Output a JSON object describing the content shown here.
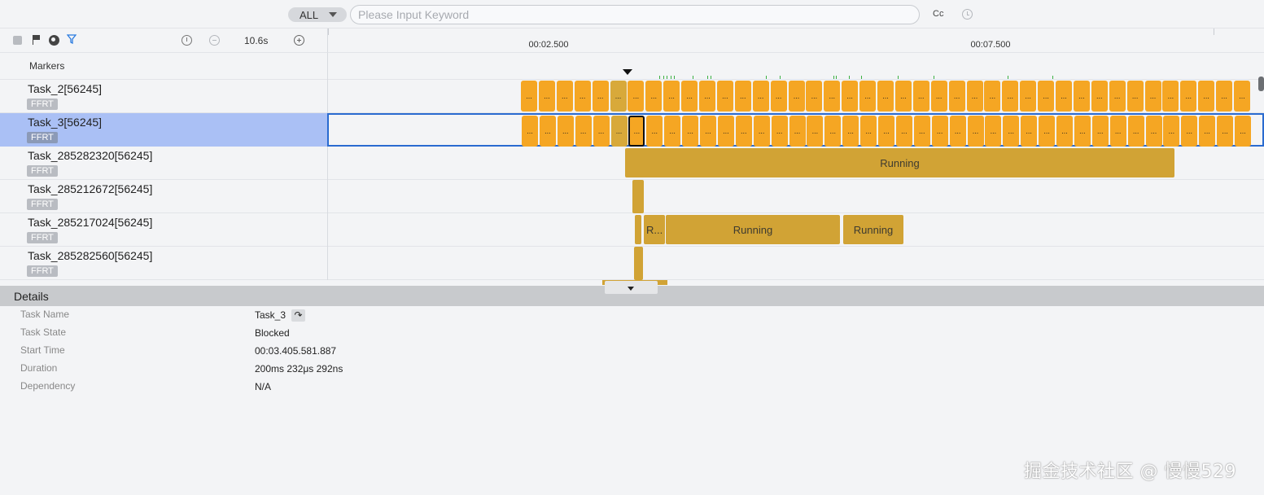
{
  "search": {
    "scope": "ALL",
    "placeholder": "Please Input Keyword",
    "value": "",
    "case_toggle": "Cc"
  },
  "toolbar": {
    "zoom_level": "10.6s",
    "icons": [
      "stop-icon",
      "flag-icon",
      "globe-icon",
      "filter-icon",
      "timer-icon",
      "zoom-out-icon",
      "zoom-in-icon"
    ]
  },
  "ruler": {
    "labels": [
      "00:02.500",
      "00:07.500"
    ]
  },
  "markers": {
    "label": "Markers"
  },
  "tracks": [
    {
      "name": "Task_2[56245]",
      "tag": "FFRT"
    },
    {
      "name": "Task_3[56245]",
      "tag": "FFRT",
      "selected": true
    },
    {
      "name": "Task_285282320[56245]",
      "tag": "FFRT",
      "slices": [
        {
          "label": "Running"
        }
      ]
    },
    {
      "name": "Task_285212672[56245]",
      "tag": "FFRT"
    },
    {
      "name": "Task_285217024[56245]",
      "tag": "FFRT",
      "slices": [
        {
          "label": "R..."
        },
        {
          "label": "Running"
        },
        {
          "label": "Running"
        }
      ]
    },
    {
      "name": "Task_285282560[56245]",
      "tag": "FFRT"
    }
  ],
  "slice_text": "...",
  "details": {
    "title": "Details",
    "rows": [
      {
        "key": "Task Name",
        "value": "Task_3"
      },
      {
        "key": "Task State",
        "value": "Blocked"
      },
      {
        "key": "Start Time",
        "value": "00:03.405.581.887"
      },
      {
        "key": "Duration",
        "value": "200ms 232μs 292ns"
      },
      {
        "key": "Dependency",
        "value": "N/A"
      }
    ]
  },
  "colors": {
    "slice": "#f5a623",
    "running": "#d1a335",
    "selection": "#2a6bd0",
    "selected_row": "#aac0f5"
  },
  "watermark": "掘金技术社区 @ 慢慢529"
}
